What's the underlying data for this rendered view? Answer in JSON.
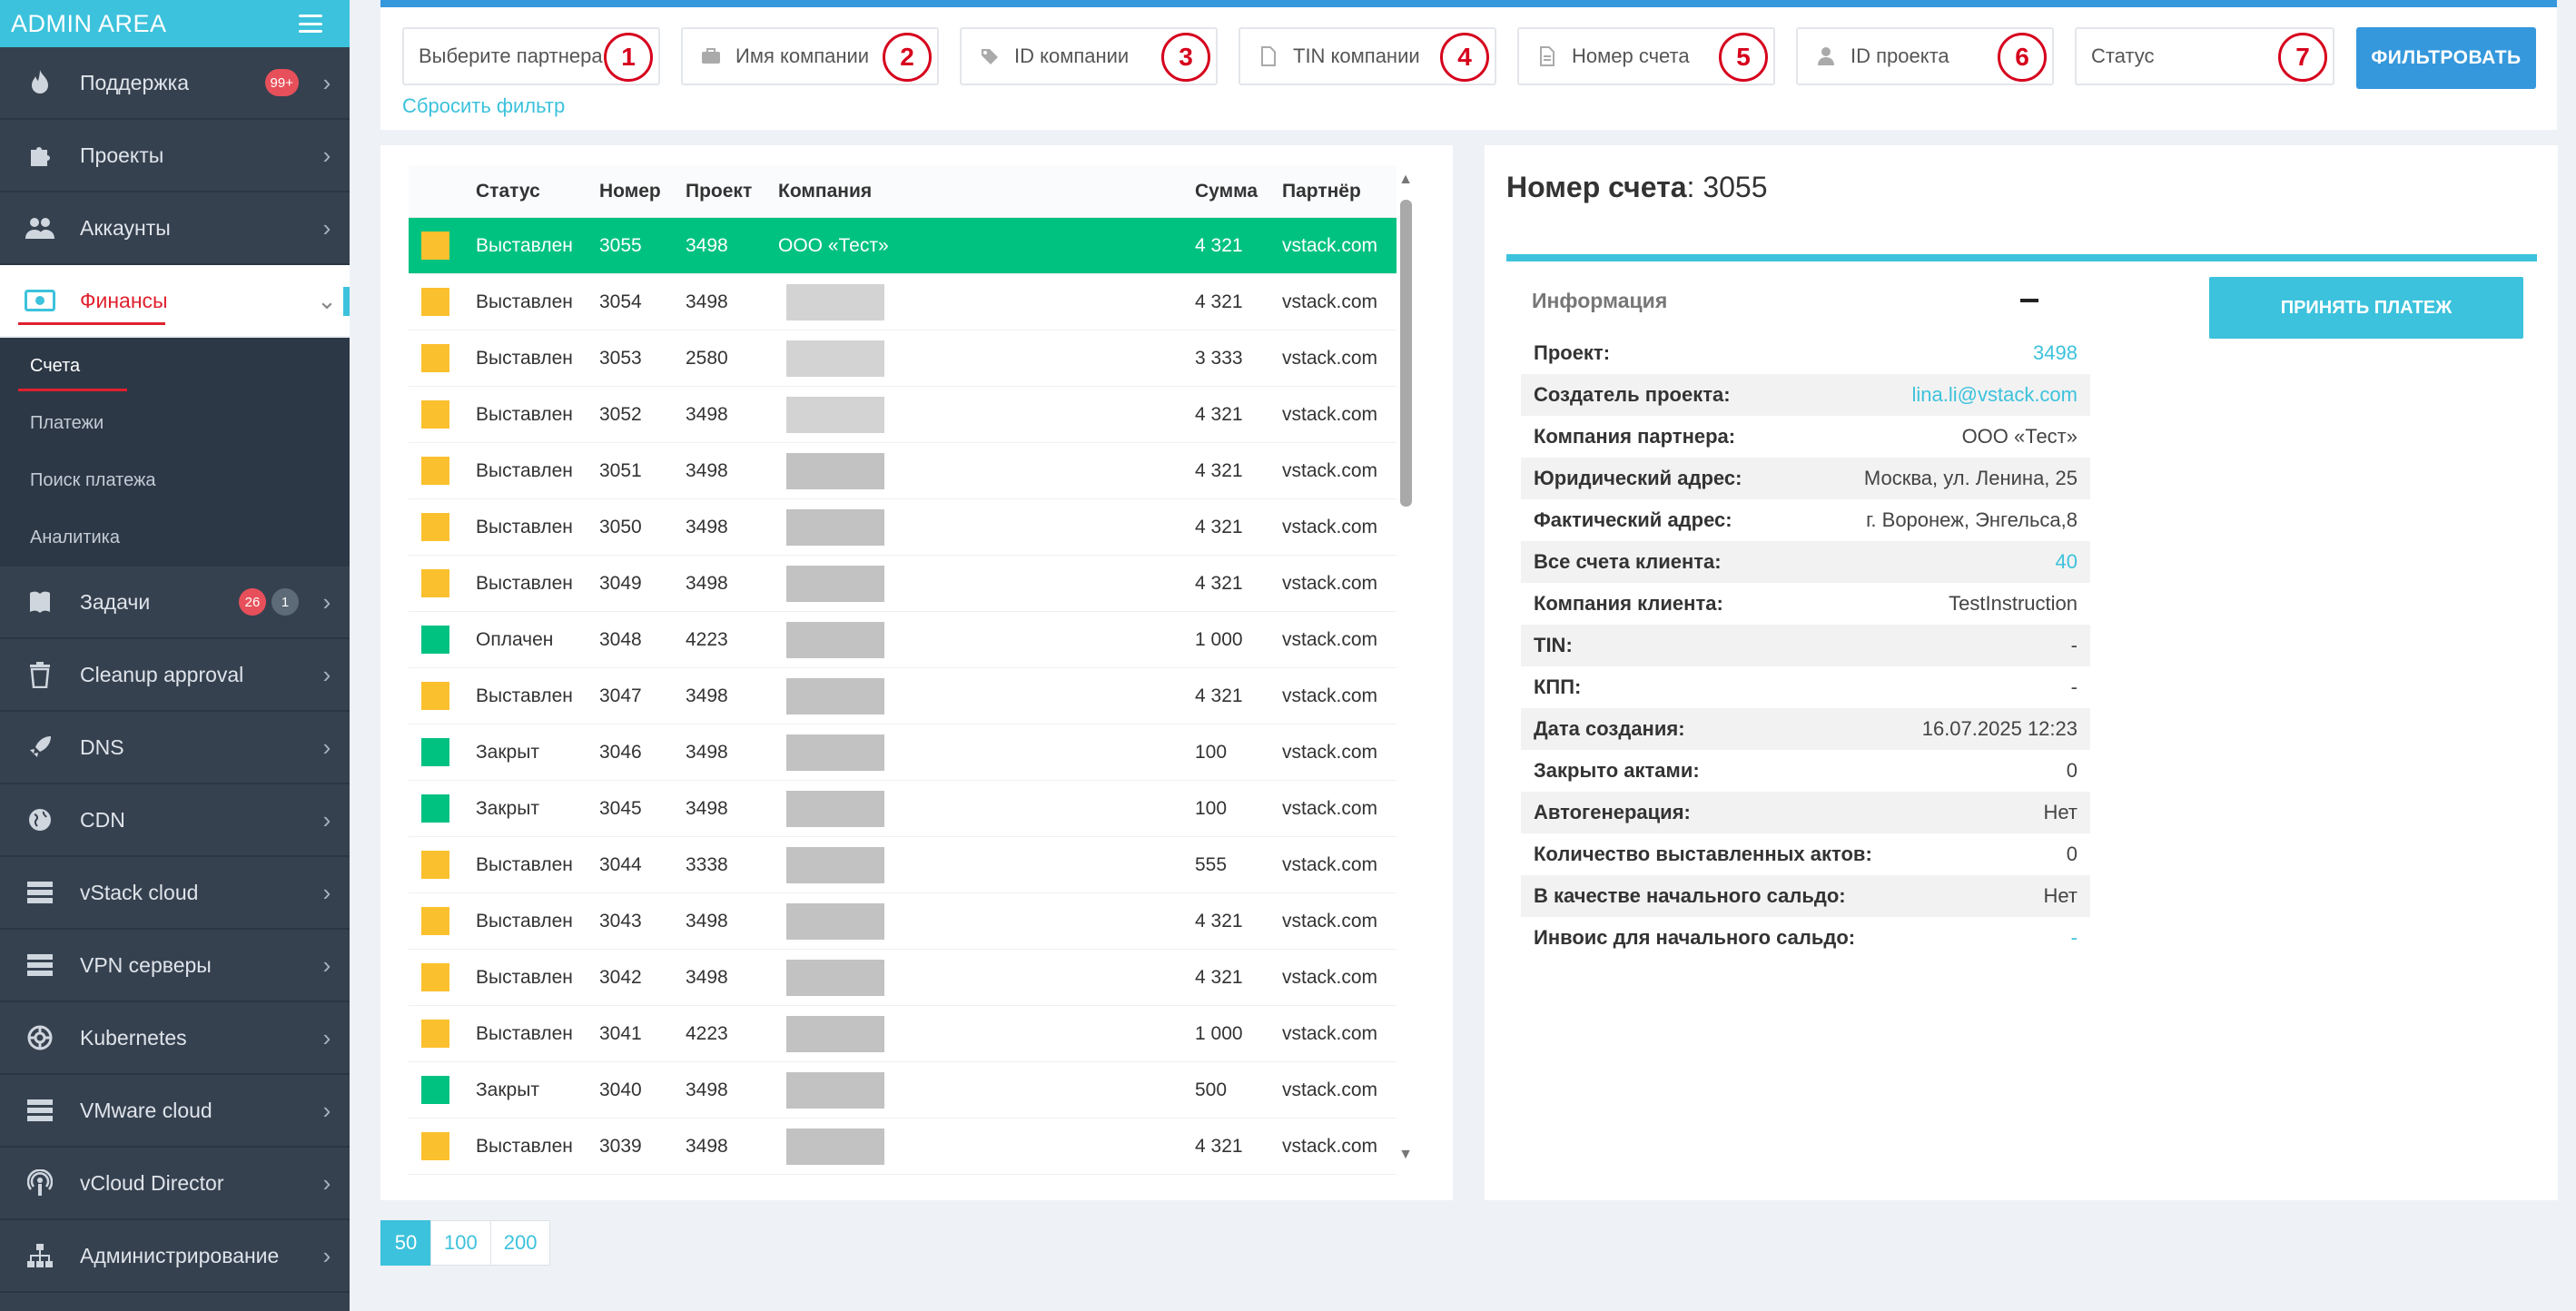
{
  "sidebar": {
    "title": "ADMIN AREA",
    "items": [
      {
        "label": "Поддержка",
        "badge": "99+",
        "icon": "fire-icon"
      },
      {
        "label": "Проекты",
        "icon": "puzzle-icon"
      },
      {
        "label": "Аккаунты",
        "icon": "users-icon"
      },
      {
        "label": "Финансы",
        "icon": "money-icon",
        "active": true
      },
      {
        "label": "Задачи",
        "badges": [
          "26",
          "1"
        ],
        "icon": "book-icon"
      },
      {
        "label": "Cleanup approval",
        "icon": "trash-icon"
      },
      {
        "label": "DNS",
        "icon": "rocket-icon"
      },
      {
        "label": "CDN",
        "icon": "globe-icon"
      },
      {
        "label": "vStack cloud",
        "icon": "server-icon"
      },
      {
        "label": "VPN серверы",
        "icon": "server-icon"
      },
      {
        "label": "Kubernetes",
        "icon": "helm-icon"
      },
      {
        "label": "VMware cloud",
        "icon": "server-icon"
      },
      {
        "label": "vCloud Director",
        "icon": "podcast-icon"
      },
      {
        "label": "Администрирование",
        "icon": "sitemap-icon"
      }
    ],
    "submenu": [
      "Счета",
      "Платежи",
      "Поиск платежа",
      "Аналитика"
    ]
  },
  "filters": {
    "fields": [
      {
        "placeholder": "Выберите партнера",
        "marker": "1"
      },
      {
        "placeholder": "Имя компании",
        "marker": "2",
        "icon": "briefcase-icon"
      },
      {
        "placeholder": "ID компании",
        "marker": "3",
        "icon": "tag-icon"
      },
      {
        "placeholder": "TIN компании",
        "marker": "4",
        "icon": "file-icon"
      },
      {
        "placeholder": "Номер счета",
        "marker": "5",
        "icon": "document-icon"
      },
      {
        "placeholder": "ID проекта",
        "marker": "6",
        "icon": "user-icon"
      },
      {
        "placeholder": "Статус",
        "marker": "7"
      }
    ],
    "submit_label": "ФИЛЬТРОВАТЬ",
    "reset_label": "Сбросить фильтр"
  },
  "table": {
    "headers": [
      "Статус",
      "Номер",
      "Проект",
      "Компания",
      "Сумма",
      "Партнёр"
    ],
    "rows": [
      {
        "status": "Выставлен",
        "color": "#fbc02d",
        "number": "3055",
        "project": "3498",
        "company": "ООО «Тест»",
        "sum": "4 321",
        "partner": "vstack.com",
        "selected": true
      },
      {
        "status": "Выставлен",
        "color": "#fbc02d",
        "number": "3054",
        "project": "3498",
        "company": "",
        "sum": "4 321",
        "partner": "vstack.com"
      },
      {
        "status": "Выставлен",
        "color": "#fbc02d",
        "number": "3053",
        "project": "2580",
        "company": "",
        "sum": "3 333",
        "partner": "vstack.com"
      },
      {
        "status": "Выставлен",
        "color": "#fbc02d",
        "number": "3052",
        "project": "3498",
        "company": "",
        "sum": "4 321",
        "partner": "vstack.com"
      },
      {
        "status": "Выставлен",
        "color": "#fbc02d",
        "number": "3051",
        "project": "3498",
        "company": "",
        "sum": "4 321",
        "partner": "vstack.com"
      },
      {
        "status": "Выставлен",
        "color": "#fbc02d",
        "number": "3050",
        "project": "3498",
        "company": "",
        "sum": "4 321",
        "partner": "vstack.com"
      },
      {
        "status": "Выставлен",
        "color": "#fbc02d",
        "number": "3049",
        "project": "3498",
        "company": "",
        "sum": "4 321",
        "partner": "vstack.com"
      },
      {
        "status": "Оплачен",
        "color": "#00c280",
        "number": "3048",
        "project": "4223",
        "company": "",
        "sum": "1 000",
        "partner": "vstack.com"
      },
      {
        "status": "Выставлен",
        "color": "#fbc02d",
        "number": "3047",
        "project": "3498",
        "company": "",
        "sum": "4 321",
        "partner": "vstack.com"
      },
      {
        "status": "Закрыт",
        "color": "#00c280",
        "number": "3046",
        "project": "3498",
        "company": "",
        "sum": "100",
        "partner": "vstack.com"
      },
      {
        "status": "Закрыт",
        "color": "#00c280",
        "number": "3045",
        "project": "3498",
        "company": "",
        "sum": "100",
        "partner": "vstack.com"
      },
      {
        "status": "Выставлен",
        "color": "#fbc02d",
        "number": "3044",
        "project": "3338",
        "company": "",
        "sum": "555",
        "partner": "vstack.com"
      },
      {
        "status": "Выставлен",
        "color": "#fbc02d",
        "number": "3043",
        "project": "3498",
        "company": "",
        "sum": "4 321",
        "partner": "vstack.com"
      },
      {
        "status": "Выставлен",
        "color": "#fbc02d",
        "number": "3042",
        "project": "3498",
        "company": "",
        "sum": "4 321",
        "partner": "vstack.com"
      },
      {
        "status": "Выставлен",
        "color": "#fbc02d",
        "number": "3041",
        "project": "4223",
        "company": "",
        "sum": "1 000",
        "partner": "vstack.com"
      },
      {
        "status": "Закрыт",
        "color": "#00c280",
        "number": "3040",
        "project": "3498",
        "company": "",
        "sum": "500",
        "partner": "vstack.com"
      },
      {
        "status": "Выставлен",
        "color": "#fbc02d",
        "number": "3039",
        "project": "3498",
        "company": "",
        "sum": "4 321",
        "partner": "vstack.com"
      }
    ]
  },
  "pagination": [
    "50",
    "100",
    "200"
  ],
  "detail": {
    "title_label": "Номер счета",
    "title_value": ": 3055",
    "section_title": "Информация",
    "accept_label": "ПРИНЯТЬ ПЛАТЕЖ",
    "rows": [
      {
        "label": "Проект:",
        "value": "3498",
        "link": true
      },
      {
        "label": "Создатель проекта:",
        "value": "lina.li@vstack.com",
        "link": true
      },
      {
        "label": "Компания партнера:",
        "value": "ООО «Тест»"
      },
      {
        "label": "Юридический адрес:",
        "value": "Москва, ул. Ленина, 25"
      },
      {
        "label": "Фактический адрес:",
        "value": "г. Воронеж, Энгельса,8"
      },
      {
        "label": "Все счета клиента:",
        "value": "40",
        "link": true
      },
      {
        "label": "Компания клиента:",
        "value": "TestInstruction"
      },
      {
        "label": "TIN:",
        "value": "-"
      },
      {
        "label": "КПП:",
        "value": "-"
      },
      {
        "label": "Дата создания:",
        "value": "16.07.2025 12:23"
      },
      {
        "label": "Закрыто актами:",
        "value": "0"
      },
      {
        "label": "Автогенерация:",
        "value": "Нет"
      },
      {
        "label": "Количество выставленных актов:",
        "value": "0"
      },
      {
        "label": "В качестве начального сальдо:",
        "value": "Нет"
      },
      {
        "label": "Инвоис для начального сальдо:",
        "value": "-",
        "link": true
      }
    ]
  },
  "colors": {
    "accent": "#3cc2dc",
    "primary": "#3598dc",
    "sidebar": "#364150",
    "marker": "#d6001c"
  }
}
